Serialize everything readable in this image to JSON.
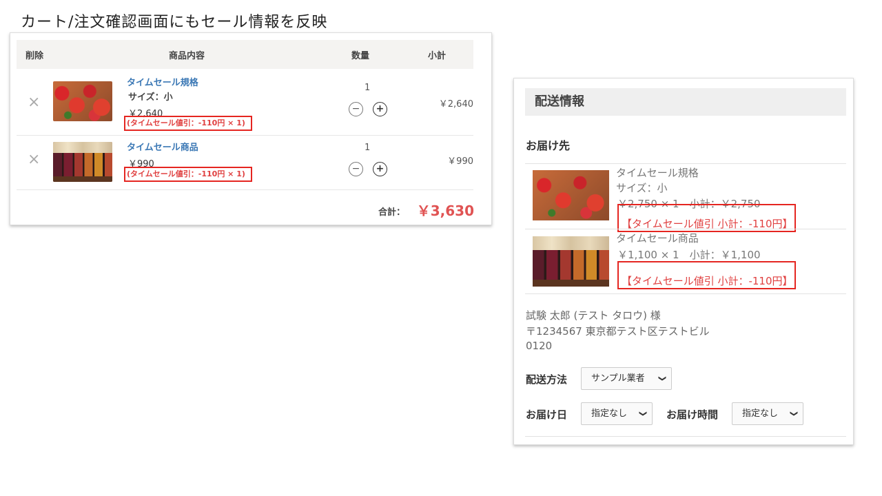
{
  "slide_title": "カート/注文確認画面にもセール情報を反映",
  "cart": {
    "header": {
      "delete": "削除",
      "content": "商品内容",
      "quantity": "数量",
      "subtotal": "小計"
    },
    "items": [
      {
        "remove": "×",
        "name": "タイムセール規格",
        "size": "サイズ：小",
        "price": "￥2,640",
        "discount": "(タイムセール値引：-110円 × 1)",
        "quantity": "1",
        "minus": "−",
        "plus": "+",
        "subtotal": "￥2,640",
        "image": "strawberries"
      },
      {
        "remove": "×",
        "name": "タイムセール商品",
        "price": "￥990",
        "discount": "(タイムセール値引：-110円 × 1)",
        "quantity": "1",
        "minus": "−",
        "plus": "+",
        "subtotal": "￥990",
        "image": "jam-jars"
      }
    ],
    "total_label": "合計：",
    "total_value": "￥3,630",
    "accent_color": "#e05353",
    "highlight_color": "#e52520"
  },
  "shipping": {
    "header": "配送情報",
    "destination_label": "お届け先",
    "items": [
      {
        "name": "タイムセール規格",
        "size": "サイズ：小",
        "price_line": "￥2,750 × 1　小計：￥2,750",
        "discount": "【タイムセール値引 小計：-110円】",
        "image": "strawberries"
      },
      {
        "name": "タイムセール商品",
        "price_line": "￥1,100 × 1　小計：￥1,100",
        "discount": "【タイムセール値引 小計：-110円】",
        "image": "jam-jars"
      }
    ],
    "address": {
      "name": "試験 太郎 (テスト タロウ) 様",
      "line": "〒1234567 東京都テスト区テストビル",
      "phone": "0120"
    },
    "method_label": "配送方法",
    "method_value": "サンプル業者",
    "date_label": "お届け日",
    "date_value": "指定なし",
    "time_label": "お届け時間",
    "time_value": "指定なし",
    "chevron": "⌄"
  }
}
